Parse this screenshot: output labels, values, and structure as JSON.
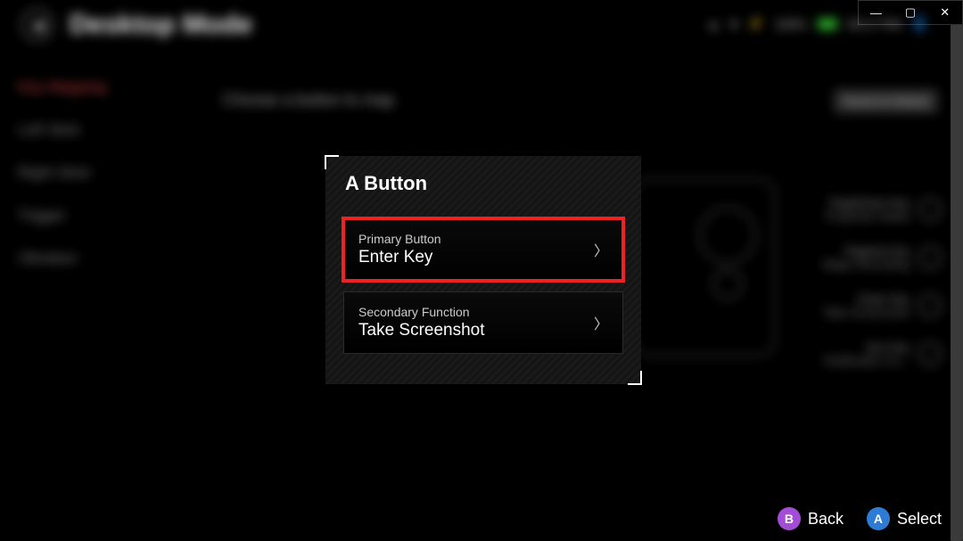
{
  "window": {
    "minimize": "—",
    "maximize": "▢",
    "close": "✕"
  },
  "header": {
    "title": "Desktop Mode",
    "battery_pct": "100%",
    "time": "06:17 PM"
  },
  "sidebar": {
    "items": [
      {
        "label": "Key Mapping",
        "active": true
      },
      {
        "label": "Left Stick",
        "active": false
      },
      {
        "label": "Right Stick",
        "active": false
      },
      {
        "label": "Trigger",
        "active": false
      },
      {
        "label": "Vibration",
        "active": false
      }
    ]
  },
  "subtitle": "Choose a button to map",
  "reset_label": "Reset to Default",
  "right_list": [
    {
      "l1": "PageDown Key",
      "l2": "Projection Mode"
    },
    {
      "l1": "PageUp Key",
      "l2": "Begin Recording"
    },
    {
      "l1": "Enter Key",
      "l2": "Take Screenshot"
    },
    {
      "l1": "Esc Key",
      "l2": "Notification Ce..."
    }
  ],
  "dialog": {
    "title": "A Button",
    "rows": [
      {
        "small": "Primary Button",
        "big": "Enter Key",
        "highlight": true
      },
      {
        "small": "Secondary Function",
        "big": "Take Screenshot",
        "highlight": false
      }
    ]
  },
  "footer": {
    "back": {
      "glyph": "B",
      "label": "Back"
    },
    "select": {
      "glyph": "A",
      "label": "Select"
    }
  }
}
